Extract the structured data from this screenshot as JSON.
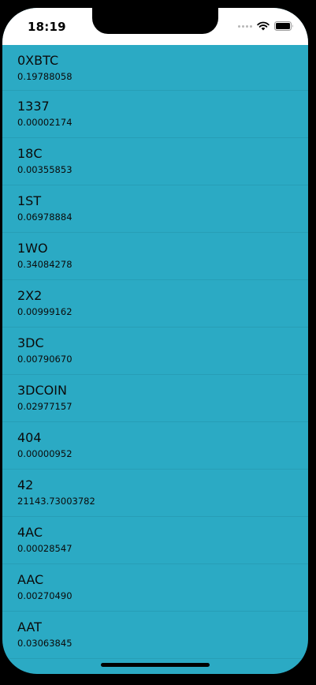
{
  "status_bar": {
    "time": "18:19",
    "icons": [
      "signal-icon",
      "wifi-icon",
      "battery-icon"
    ]
  },
  "list": {
    "items": [
      {
        "name": "0XBTC",
        "value": "0.19788058"
      },
      {
        "name": "1337",
        "value": "0.00002174"
      },
      {
        "name": "18C",
        "value": "0.00355853"
      },
      {
        "name": "1ST",
        "value": "0.06978884"
      },
      {
        "name": "1WO",
        "value": "0.34084278"
      },
      {
        "name": "2X2",
        "value": "0.00999162"
      },
      {
        "name": "3DC",
        "value": "0.00790670"
      },
      {
        "name": "3DCOIN",
        "value": "0.02977157"
      },
      {
        "name": "404",
        "value": "0.00000952"
      },
      {
        "name": "42",
        "value": "21143.73003782"
      },
      {
        "name": "4AC",
        "value": "0.00028547"
      },
      {
        "name": "AAC",
        "value": "0.00270490"
      },
      {
        "name": "AAT",
        "value": "0.03063845"
      },
      {
        "name": "",
        "value": ""
      }
    ]
  },
  "colors": {
    "background": "#2baac4",
    "status_bar": "#ffffff",
    "text": "#0b0b0b"
  }
}
